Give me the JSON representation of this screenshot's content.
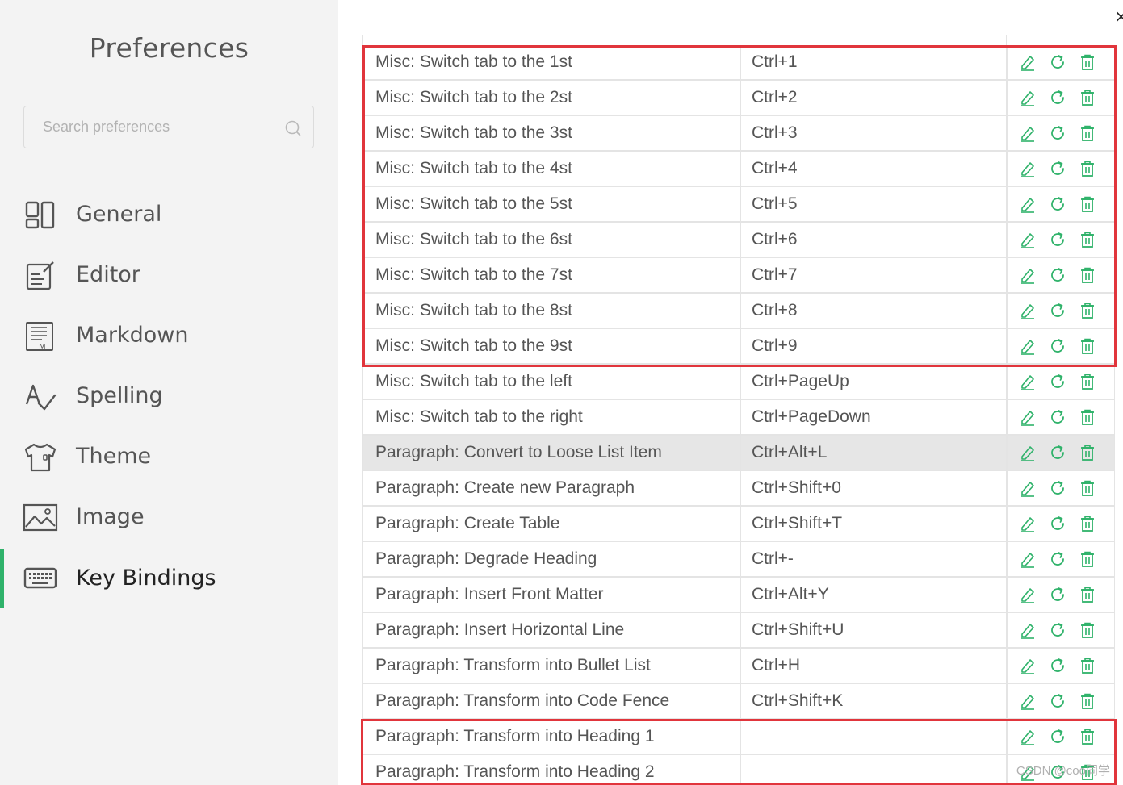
{
  "sidebar": {
    "title": "Preferences",
    "search_placeholder": "Search preferences",
    "items": [
      {
        "label": "General",
        "icon": "general-icon"
      },
      {
        "label": "Editor",
        "icon": "editor-icon"
      },
      {
        "label": "Markdown",
        "icon": "markdown-icon"
      },
      {
        "label": "Spelling",
        "icon": "spelling-icon"
      },
      {
        "label": "Theme",
        "icon": "theme-icon"
      },
      {
        "label": "Image",
        "icon": "image-icon"
      },
      {
        "label": "Key Bindings",
        "icon": "keyboard-icon"
      }
    ],
    "active": "Key Bindings",
    "accent_color": "#2fb26a"
  },
  "close_label": "×",
  "action_color": "#2fb26a",
  "highlight_box_color": "#e1353c",
  "bindings": [
    {
      "desc": "Misc: Switch tab to the 1st",
      "key": "Ctrl+1"
    },
    {
      "desc": "Misc: Switch tab to the 2st",
      "key": "Ctrl+2"
    },
    {
      "desc": "Misc: Switch tab to the 3st",
      "key": "Ctrl+3"
    },
    {
      "desc": "Misc: Switch tab to the 4st",
      "key": "Ctrl+4"
    },
    {
      "desc": "Misc: Switch tab to the 5st",
      "key": "Ctrl+5"
    },
    {
      "desc": "Misc: Switch tab to the 6st",
      "key": "Ctrl+6"
    },
    {
      "desc": "Misc: Switch tab to the 7st",
      "key": "Ctrl+7"
    },
    {
      "desc": "Misc: Switch tab to the 8st",
      "key": "Ctrl+8"
    },
    {
      "desc": "Misc: Switch tab to the 9st",
      "key": "Ctrl+9"
    },
    {
      "desc": "Misc: Switch tab to the left",
      "key": "Ctrl+PageUp"
    },
    {
      "desc": "Misc: Switch tab to the right",
      "key": "Ctrl+PageDown"
    },
    {
      "desc": "Paragraph: Convert to Loose List Item",
      "key": "Ctrl+Alt+L"
    },
    {
      "desc": "Paragraph: Create new Paragraph",
      "key": "Ctrl+Shift+0"
    },
    {
      "desc": "Paragraph: Create Table",
      "key": "Ctrl+Shift+T"
    },
    {
      "desc": "Paragraph: Degrade Heading",
      "key": "Ctrl+-"
    },
    {
      "desc": "Paragraph: Insert Front Matter",
      "key": "Ctrl+Alt+Y"
    },
    {
      "desc": "Paragraph: Insert Horizontal Line",
      "key": "Ctrl+Shift+U"
    },
    {
      "desc": "Paragraph: Transform into Bullet List",
      "key": "Ctrl+H"
    },
    {
      "desc": "Paragraph: Transform into Code Fence",
      "key": "Ctrl+Shift+K"
    },
    {
      "desc": "Paragraph: Transform into Heading 1",
      "key": ""
    },
    {
      "desc": "Paragraph: Transform into Heading 2",
      "key": ""
    }
  ],
  "highlighted_row": "Paragraph: Convert to Loose List Item",
  "watermark": "CSDN @coo同学"
}
